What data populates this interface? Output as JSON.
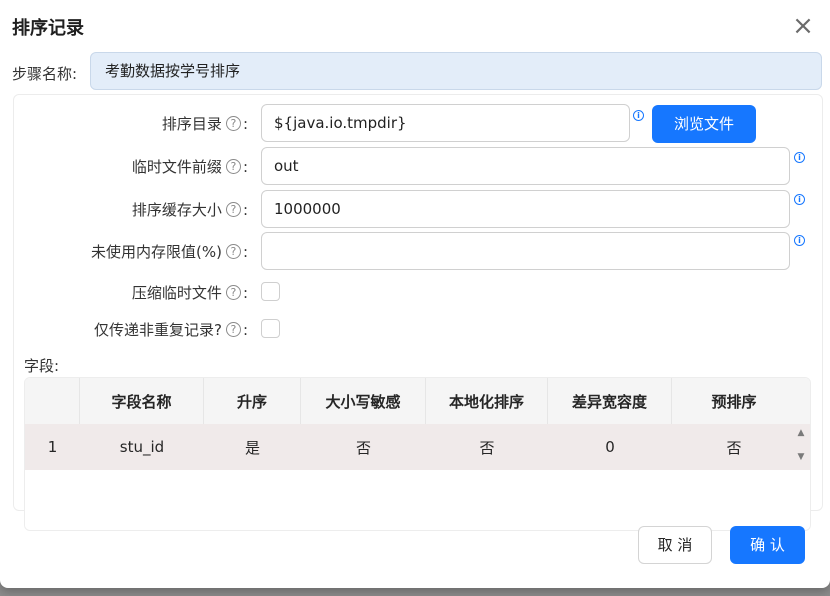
{
  "dialog": {
    "title": "排序记录",
    "close_glyph": "×"
  },
  "step": {
    "label": "步骤名称:",
    "value": "考勤数据按学号排序"
  },
  "form": {
    "rows": [
      {
        "label": "排序目录",
        "value": "${java.io.tmpdir}",
        "placeholder": ""
      },
      {
        "label": "临时文件前缀",
        "value": "out",
        "placeholder": ""
      },
      {
        "label": "排序缓存大小",
        "value": "1000000",
        "placeholder": ""
      },
      {
        "label": "未使用内存限值(%)",
        "value": "",
        "placeholder": ""
      },
      {
        "label": "压缩临时文件",
        "checked": false
      },
      {
        "label": "仅传递非重复记录?",
        "checked": false
      }
    ],
    "browse_label": "浏览文件",
    "help_glyph": "?",
    "info_glyph": "i",
    "colon": ":"
  },
  "fields": {
    "title": "字段:",
    "columns": [
      "",
      "字段名称",
      "升序",
      "大小写敏感",
      "本地化排序",
      "差异宽容度",
      "预排序"
    ],
    "rows": [
      [
        "1",
        "stu_id",
        "是",
        "否",
        "否",
        "0",
        "否"
      ]
    ]
  },
  "footer": {
    "cancel_label": "取 消",
    "confirm_label": "确 认"
  },
  "icons": {
    "close": "close-icon",
    "help": "question-circle-icon",
    "info": "info-circle-icon",
    "scroll_up": "scroll-up-icon",
    "scroll_down": "scroll-down-icon"
  },
  "colors": {
    "primary": "#1677ff",
    "step_bg": "#e3edf9",
    "row_bg": "#f0eaea"
  }
}
